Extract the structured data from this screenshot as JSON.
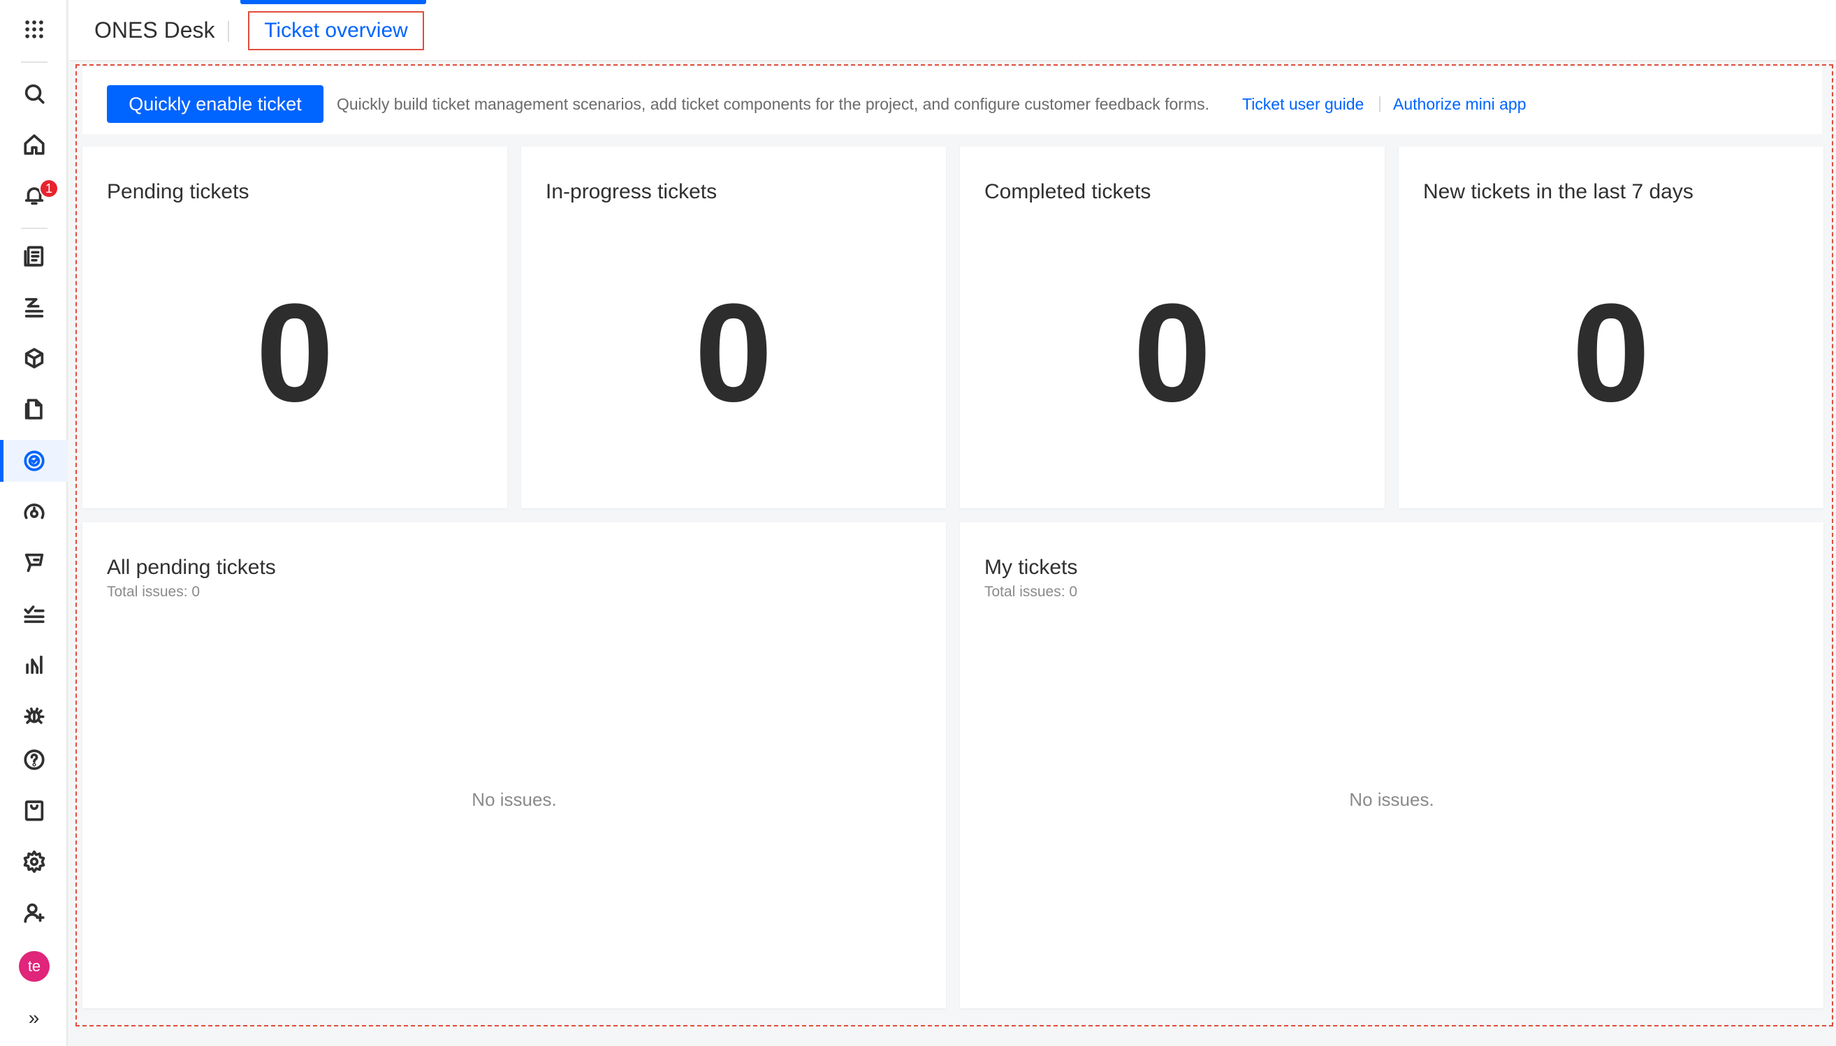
{
  "app": {
    "name": "ONES Desk",
    "active_tab": "Ticket overview"
  },
  "sidebar": {
    "items": [
      {
        "name": "apps-grid-icon"
      },
      {
        "name": "search-icon"
      },
      {
        "name": "home-icon"
      },
      {
        "name": "bell-icon",
        "badge": "1"
      },
      {
        "name": "project-icon"
      },
      {
        "name": "task-list-icon"
      },
      {
        "name": "package-icon"
      },
      {
        "name": "document-icon"
      },
      {
        "name": "desk-icon",
        "active": true
      },
      {
        "name": "performance-icon"
      },
      {
        "name": "pipeline-icon"
      },
      {
        "name": "checklist-icon"
      },
      {
        "name": "analytics-icon"
      },
      {
        "name": "bug-icon"
      },
      {
        "name": "help-icon"
      },
      {
        "name": "market-icon"
      },
      {
        "name": "settings-icon"
      },
      {
        "name": "add-user-icon"
      }
    ],
    "avatar": "te",
    "expand": "»"
  },
  "banner": {
    "button": "Quickly enable ticket",
    "description": "Quickly build ticket management scenarios, add ticket components for the project, and configure customer feedback forms.",
    "link_guide": "Ticket user guide",
    "link_app": "Authorize mini app"
  },
  "stats": [
    {
      "title": "Pending tickets",
      "value": "0"
    },
    {
      "title": "In-progress tickets",
      "value": "0"
    },
    {
      "title": "Completed tickets",
      "value": "0"
    },
    {
      "title": "New tickets in the last 7 days",
      "value": "0"
    }
  ],
  "lists": [
    {
      "title": "All pending tickets",
      "subtitle": "Total issues: 0",
      "empty": "No issues."
    },
    {
      "title": "My tickets",
      "subtitle": "Total issues: 0",
      "empty": "No issues."
    }
  ],
  "colors": {
    "primary": "#0064ff",
    "highlight": "#e24c3c",
    "badge": "#e7242f",
    "avatar": "#e0257a"
  }
}
